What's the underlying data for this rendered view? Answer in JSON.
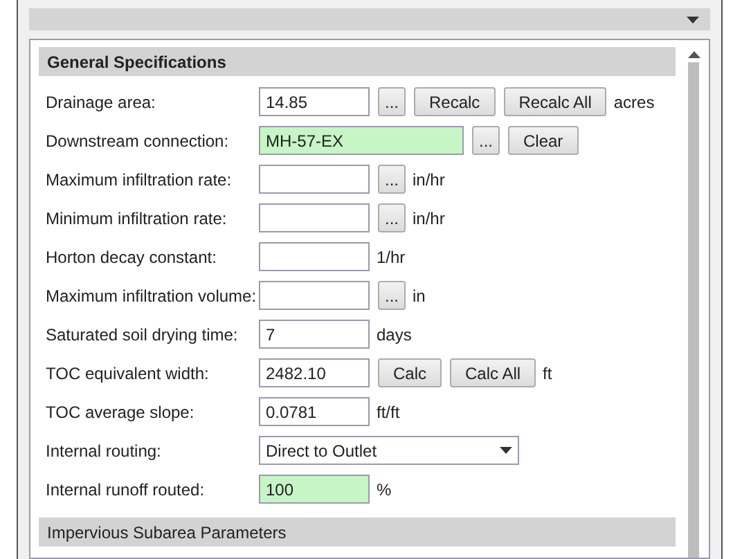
{
  "section": {
    "title": "General Specifications"
  },
  "rows": [
    {
      "kind": "field",
      "label": "Drainage area:",
      "value": "14.85",
      "highlighted": false,
      "buttons": [
        "...",
        "Recalc",
        "Recalc All"
      ],
      "unit": "acres"
    },
    {
      "kind": "wide_field",
      "label": "Downstream connection:",
      "value": "MH-57-EX",
      "highlighted": true,
      "buttons": [
        "...",
        "Clear"
      ]
    },
    {
      "kind": "field",
      "label": "Maximum infiltration rate:",
      "value": "",
      "highlighted": false,
      "buttons": [
        "..."
      ],
      "unit": "in/hr"
    },
    {
      "kind": "field",
      "label": "Minimum infiltration rate:",
      "value": "",
      "highlighted": false,
      "buttons": [
        "..."
      ],
      "unit": "in/hr"
    },
    {
      "kind": "field",
      "label": "Horton decay constant:",
      "value": "",
      "highlighted": false,
      "buttons": [],
      "unit": "1/hr"
    },
    {
      "kind": "field",
      "label": "Maximum infiltration volume:",
      "value": "",
      "highlighted": false,
      "buttons": [
        "..."
      ],
      "unit": "in"
    },
    {
      "kind": "field",
      "label": "Saturated soil drying time:",
      "value": "7",
      "highlighted": false,
      "buttons": [],
      "unit": "days"
    },
    {
      "kind": "field",
      "label": "TOC equivalent width:",
      "value": "2482.10",
      "highlighted": false,
      "buttons": [
        "Calc",
        "Calc All"
      ],
      "unit": "ft"
    },
    {
      "kind": "field",
      "label": "TOC average slope:",
      "value": "0.0781",
      "highlighted": false,
      "buttons": [],
      "unit": "ft/ft"
    },
    {
      "kind": "dropdown",
      "label": "Internal routing:",
      "value": "Direct to Outlet"
    },
    {
      "kind": "field",
      "label": "Internal runoff routed:",
      "value": "100",
      "highlighted": true,
      "buttons": [],
      "unit": "%"
    }
  ],
  "next_section": {
    "title": "Impervious Subarea Parameters"
  }
}
